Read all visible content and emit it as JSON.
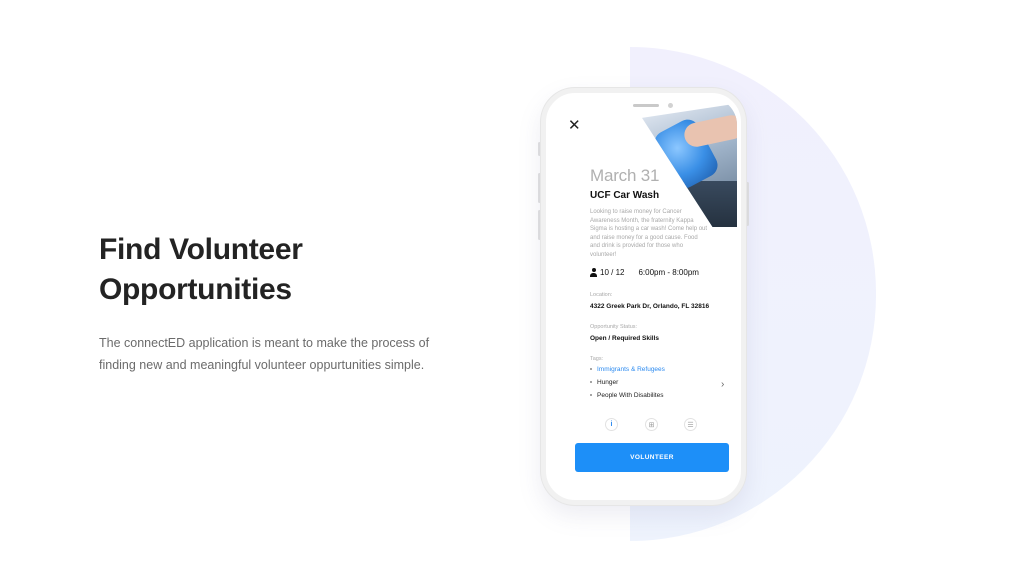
{
  "intro": {
    "heading_line1": "Find Volunteer",
    "heading_line2": "Opportunities",
    "description_line1": "The connectED application is meant to make the process of",
    "description_line2": "finding new and meaningful volunteer oppurtunities simple."
  },
  "event": {
    "close_glyph": "✕",
    "date": "March 31",
    "title": "UCF Car Wash",
    "description": "Looking to raise money for Cancer Awareness Month, the fraternity Kappa Sigma is hosting a car wash! Come help out and raise money for a good cause. Food and drink is provided for those who volunteer!",
    "attendance": "10 / 12",
    "time": "6:00pm - 8:00pm",
    "location_label": "Location:",
    "location": "4322 Greek Park Dr, Orlando, FL 32816",
    "status_label": "Opportunity Status:",
    "status": "Open / Required Skills",
    "tags_label": "Tags:",
    "tags": [
      "Immigrants & Refugees",
      "Hunger",
      "People With Disabilites"
    ],
    "chevron_glyph": "›",
    "tab_icons": [
      {
        "name": "info-icon",
        "glyph": "i"
      },
      {
        "name": "grid-icon",
        "glyph": "⊞"
      },
      {
        "name": "list-icon",
        "glyph": "☰"
      }
    ],
    "volunteer_button": "VOLUNTEER"
  },
  "colors": {
    "accent": "#1d8ff8",
    "link": "#2b8af0",
    "background_shape": "#f0f1fd"
  }
}
